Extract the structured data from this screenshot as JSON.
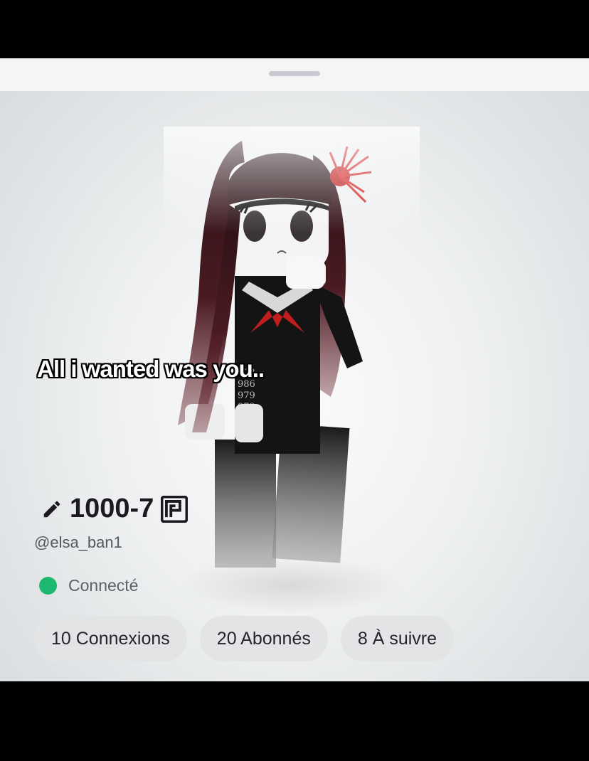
{
  "overlay": {
    "caption": "All i wanted was you.."
  },
  "profile": {
    "display_name": "1000-7",
    "username": "@elsa_ban1",
    "status": "Connecté",
    "status_color": "#1fb870"
  },
  "stats": {
    "connections": "10 Connexions",
    "followers": "20 Abonnés",
    "following": "8 À suivre"
  },
  "icons": {
    "edit": "pencil-icon",
    "badge": "premium-icon"
  }
}
